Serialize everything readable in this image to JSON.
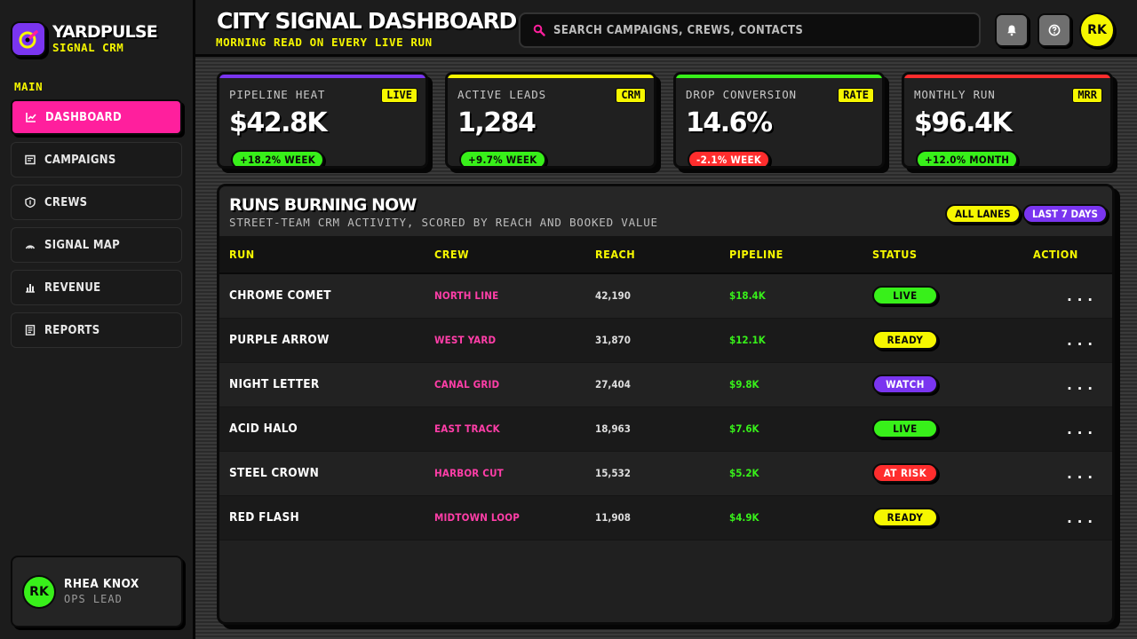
{
  "brand": {
    "name": "YARDPULSE",
    "subtitle": "SIGNAL CRM"
  },
  "sidebar": {
    "section_label": "MAIN",
    "items": [
      {
        "label": "DASHBOARD",
        "icon": "chart-line-icon",
        "active": true
      },
      {
        "label": "CAMPAIGNS",
        "icon": "campaign-card-icon",
        "active": false
      },
      {
        "label": "CREWS",
        "icon": "shield-icon",
        "active": false
      },
      {
        "label": "SIGNAL MAP",
        "icon": "signal-arc-icon",
        "active": false
      },
      {
        "label": "REVENUE",
        "icon": "bar-chart-icon",
        "active": false
      },
      {
        "label": "REPORTS",
        "icon": "document-icon",
        "active": false
      }
    ],
    "user": {
      "initials": "RK",
      "name": "RHEA KNOX",
      "role": "OPS LEAD"
    }
  },
  "header": {
    "title": "CITY SIGNAL DASHBOARD",
    "subtitle": "MORNING READ ON EVERY LIVE RUN",
    "search_placeholder": "SEARCH CAMPAIGNS, CREWS, CONTACTS",
    "avatar_initials": "RK"
  },
  "stats": [
    {
      "label": "PIPELINE HEAT",
      "tag": "LIVE",
      "value": "$42.8K",
      "delta": "+18.2% WEEK",
      "accent": "#7a35f0",
      "delta_color": "#38f01a"
    },
    {
      "label": "ACTIVE LEADS",
      "tag": "CRM",
      "value": "1,284",
      "delta": "+9.7% WEEK",
      "accent": "#f6f700",
      "delta_color": "#38f01a"
    },
    {
      "label": "DROP CONVERSION",
      "tag": "RATE",
      "value": "14.6%",
      "delta": "-2.1% WEEK",
      "accent": "#38f01a",
      "delta_color": "#ff2d2d"
    },
    {
      "label": "MONTHLY RUN",
      "tag": "MRR",
      "value": "$96.4K",
      "delta": "+12.0% MONTH",
      "accent": "#ff2d2d",
      "delta_color": "#38f01a"
    }
  ],
  "runs": {
    "title": "RUNS BURNING NOW",
    "subtitle": "STREET-TEAM CRM ACTIVITY, SCORED BY REACH AND BOOKED VALUE",
    "filters": [
      {
        "label": "ALL LANES",
        "bg": "#f6f700",
        "fg": "#0a0a0a"
      },
      {
        "label": "LAST 7 DAYS",
        "bg": "#7a35f0",
        "fg": "#ffffff"
      }
    ],
    "columns": [
      "RUN",
      "CREW",
      "REACH",
      "PIPELINE",
      "STATUS",
      "ACTION"
    ],
    "rows": [
      {
        "run": "CHROME COMET",
        "crew": "NORTH LINE",
        "reach": "42,190",
        "pipeline": "$18.4K",
        "status": "LIVE",
        "action": "...",
        "status_bg": "#38f01a",
        "status_fg": "#0a0a0a"
      },
      {
        "run": "PURPLE ARROW",
        "crew": "WEST YARD",
        "reach": "31,870",
        "pipeline": "$12.1K",
        "status": "READY",
        "action": "...",
        "status_bg": "#f6f700",
        "status_fg": "#0a0a0a"
      },
      {
        "run": "NIGHT LETTER",
        "crew": "CANAL GRID",
        "reach": "27,404",
        "pipeline": "$9.8K",
        "status": "WATCH",
        "action": "...",
        "status_bg": "#7a35f0",
        "status_fg": "#ffffff"
      },
      {
        "run": "ACID HALO",
        "crew": "EAST TRACK",
        "reach": "18,963",
        "pipeline": "$7.6K",
        "status": "LIVE",
        "action": "...",
        "status_bg": "#38f01a",
        "status_fg": "#0a0a0a"
      },
      {
        "run": "STEEL CROWN",
        "crew": "HARBOR CUT",
        "reach": "15,532",
        "pipeline": "$5.2K",
        "status": "AT RISK",
        "action": "...",
        "status_bg": "#ff2d2d",
        "status_fg": "#ffffff"
      },
      {
        "run": "RED FLASH",
        "crew": "MIDTOWN LOOP",
        "reach": "11,908",
        "pipeline": "$4.9K",
        "status": "READY",
        "action": "...",
        "status_bg": "#f6f700",
        "status_fg": "#0a0a0a"
      }
    ]
  },
  "colors": {
    "accent_pink": "#ff1f9d",
    "accent_yellow": "#f6f700",
    "accent_green": "#38f01a",
    "accent_purple": "#7a35f0",
    "accent_red": "#ff2d2d"
  }
}
